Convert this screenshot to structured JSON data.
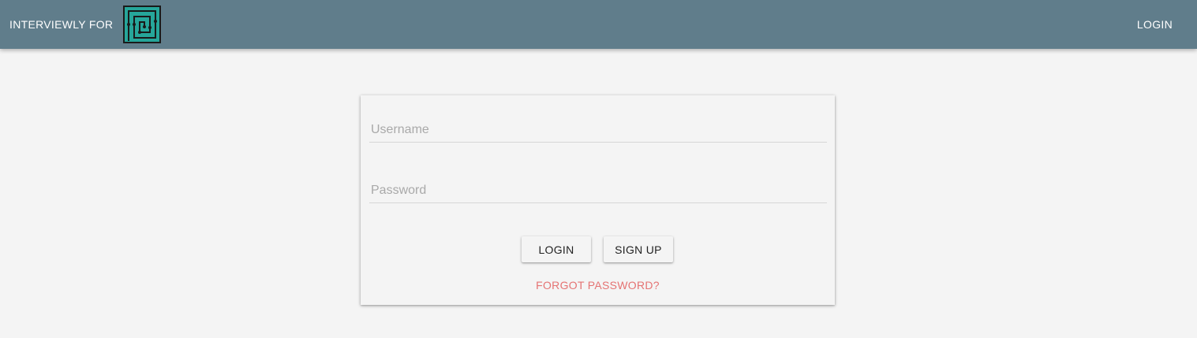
{
  "header": {
    "brand_text": "INTERVIEWLY FOR",
    "logo_icon": "maze-logo-icon",
    "login_link": "LOGIN",
    "bar_color": "#607d8b",
    "logo_color": "#26a69a"
  },
  "login_form": {
    "username_placeholder": "Username",
    "password_placeholder": "Password",
    "login_button": "LOGIN",
    "signup_button": "SIGN UP",
    "forgot_password_link": "FORGOT PASSWORD?",
    "link_color": "#e57373"
  }
}
